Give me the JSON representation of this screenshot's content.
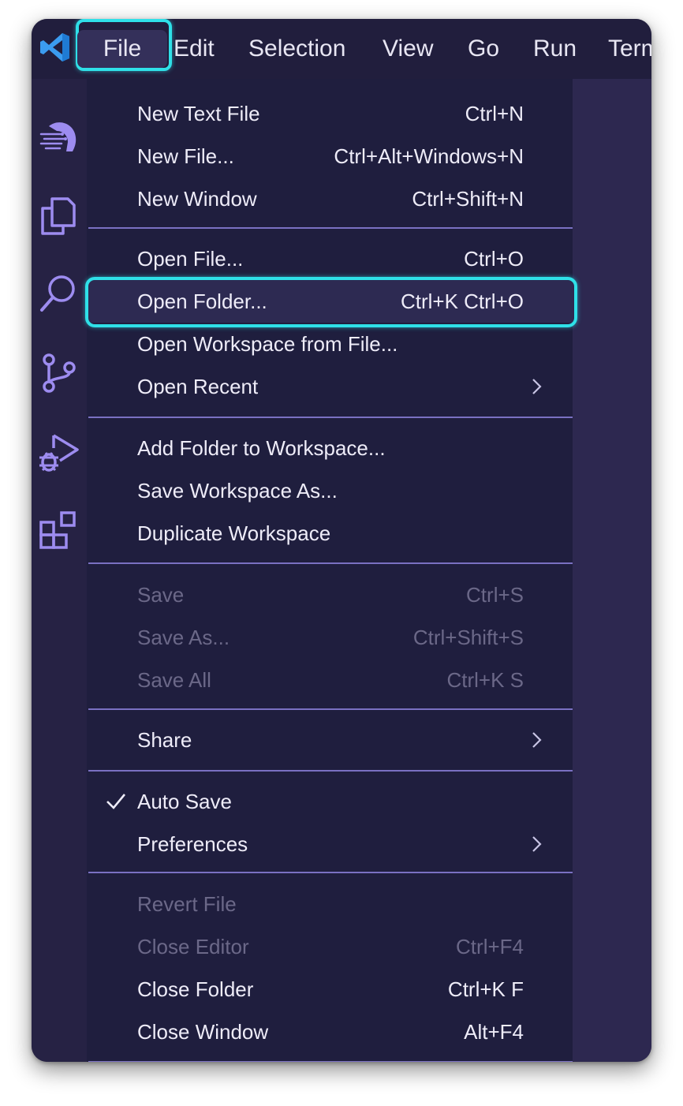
{
  "colors": {
    "accent_highlight": "#2fe0e8",
    "menu_bg": "#1f1e3e",
    "separator": "#7a70c2",
    "icon_purple": "#9d8cf0",
    "logo_blue": "#3b9cf0"
  },
  "menubar": {
    "logo_icon": "vscode-logo-icon",
    "items": [
      "File",
      "Edit",
      "Selection",
      "View",
      "Go",
      "Run",
      "Term"
    ]
  },
  "activity_bar": {
    "icons": [
      "copilot-icon",
      "explorer-icon",
      "search-icon",
      "source-control-icon",
      "run-debug-icon",
      "extensions-icon"
    ]
  },
  "file_menu": {
    "groups": [
      [
        {
          "label": "New Text File",
          "shortcut": "Ctrl+N"
        },
        {
          "label": "New File...",
          "shortcut": "Ctrl+Alt+Windows+N"
        },
        {
          "label": "New Window",
          "shortcut": "Ctrl+Shift+N"
        }
      ],
      [
        {
          "label": "Open File...",
          "shortcut": "Ctrl+O"
        },
        {
          "label": "Open Folder...",
          "shortcut": "Ctrl+K Ctrl+O",
          "highlighted": true
        },
        {
          "label": "Open Workspace from File...",
          "shortcut": ""
        },
        {
          "label": "Open Recent",
          "shortcut": "",
          "submenu": true
        }
      ],
      [
        {
          "label": "Add Folder to Workspace...",
          "shortcut": ""
        },
        {
          "label": "Save Workspace As...",
          "shortcut": ""
        },
        {
          "label": "Duplicate Workspace",
          "shortcut": ""
        }
      ],
      [
        {
          "label": "Save",
          "shortcut": "Ctrl+S",
          "disabled": true
        },
        {
          "label": "Save As...",
          "shortcut": "Ctrl+Shift+S",
          "disabled": true
        },
        {
          "label": "Save All",
          "shortcut": "Ctrl+K S",
          "disabled": true
        }
      ],
      [
        {
          "label": "Share",
          "shortcut": "",
          "submenu": true
        }
      ],
      [
        {
          "label": "Auto Save",
          "shortcut": "",
          "checked": true
        },
        {
          "label": "Preferences",
          "shortcut": "",
          "submenu": true
        }
      ],
      [
        {
          "label": "Revert File",
          "shortcut": "",
          "disabled": true
        },
        {
          "label": "Close Editor",
          "shortcut": "Ctrl+F4",
          "disabled": true
        },
        {
          "label": "Close Folder",
          "shortcut": "Ctrl+K F"
        },
        {
          "label": "Close Window",
          "shortcut": "Alt+F4"
        }
      ]
    ]
  }
}
